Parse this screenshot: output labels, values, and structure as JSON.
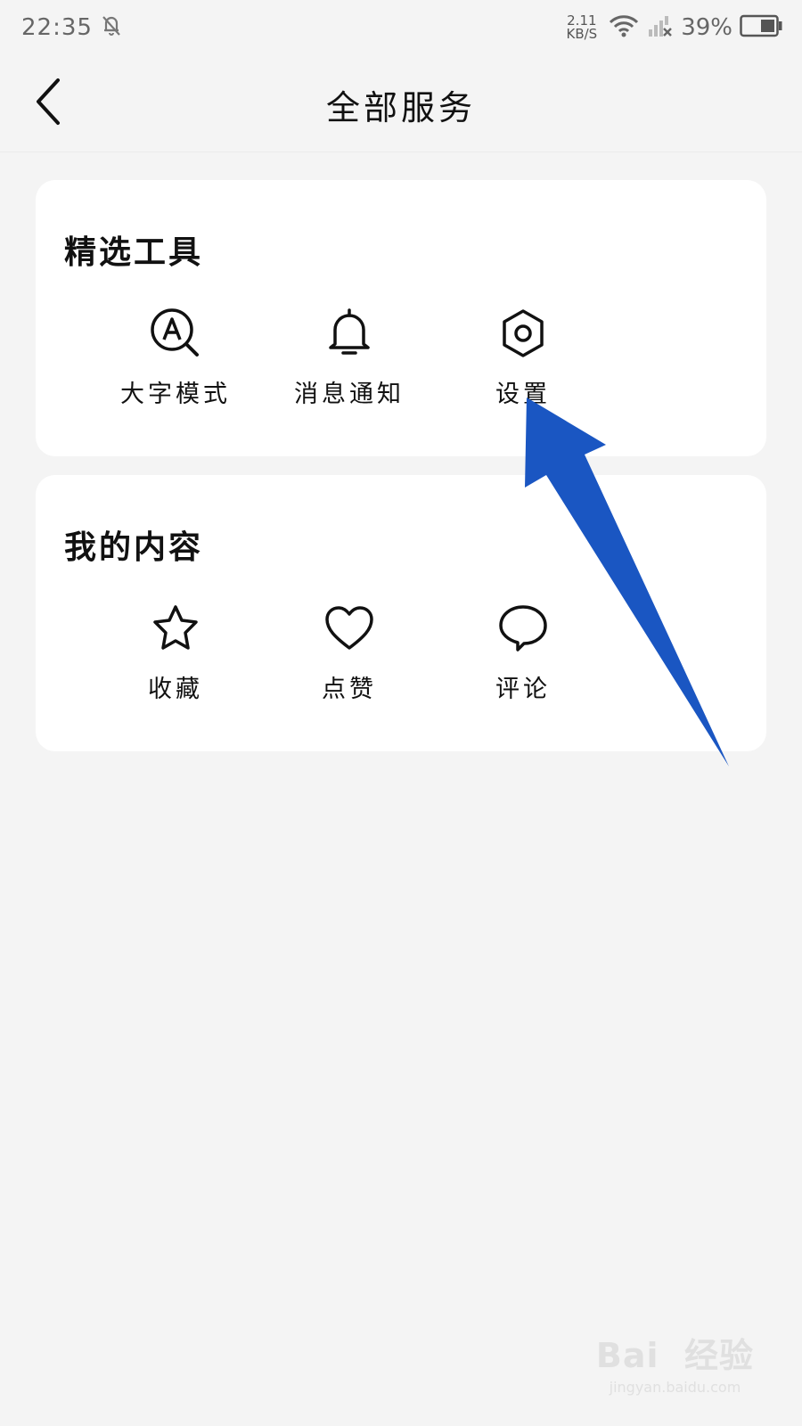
{
  "status_bar": {
    "time": "22:35",
    "net_speed_value": "2.11",
    "net_speed_unit": "KB/S",
    "battery_percent": "39%"
  },
  "header": {
    "title": "全部服务",
    "back_icon": "chevron-left-icon"
  },
  "sections": [
    {
      "title": "精选工具",
      "items": [
        {
          "label": "大字模式",
          "icon": "large-font-icon"
        },
        {
          "label": "消息通知",
          "icon": "bell-icon"
        },
        {
          "label": "设置",
          "icon": "hexagon-gear-icon"
        }
      ]
    },
    {
      "title": "我的内容",
      "items": [
        {
          "label": "收藏",
          "icon": "star-icon"
        },
        {
          "label": "点赞",
          "icon": "heart-icon"
        },
        {
          "label": "评论",
          "icon": "chat-bubble-icon"
        }
      ]
    }
  ],
  "annotation": {
    "arrow_color": "#1a56c2"
  },
  "watermark": {
    "brand": "Bai  经验",
    "url": "jingyan.baidu.com"
  }
}
